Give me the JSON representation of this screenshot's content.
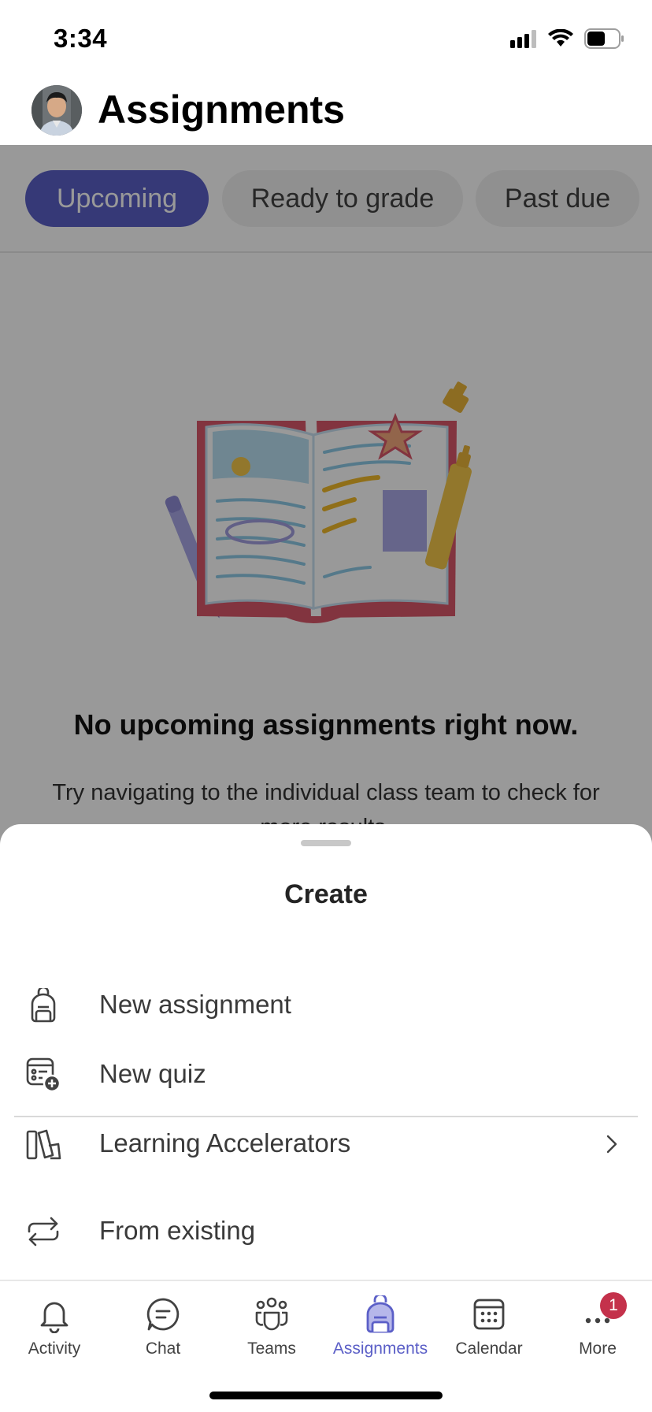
{
  "status_bar": {
    "time": "3:34"
  },
  "header": {
    "title": "Assignments"
  },
  "tabs": [
    {
      "label": "Upcoming",
      "selected": true
    },
    {
      "label": "Ready to grade",
      "selected": false
    },
    {
      "label": "Past due",
      "selected": false
    }
  ],
  "empty_state": {
    "title": "No upcoming assignments right now.",
    "description": "Try navigating to the individual class team to check for more results."
  },
  "sheet": {
    "title": "Create",
    "items": [
      {
        "label": "New assignment",
        "icon": "backpack-icon"
      },
      {
        "label": "New quiz",
        "icon": "quiz-add-icon"
      },
      {
        "label": "Learning Accelerators",
        "icon": "books-icon",
        "has_chevron": true
      },
      {
        "label": "From existing",
        "icon": "repeat-icon"
      }
    ]
  },
  "bottom_nav": {
    "items": [
      {
        "label": "Activity",
        "icon": "bell-icon"
      },
      {
        "label": "Chat",
        "icon": "chat-icon"
      },
      {
        "label": "Teams",
        "icon": "teams-icon"
      },
      {
        "label": "Assignments",
        "icon": "backpack-icon",
        "selected": true
      },
      {
        "label": "Calendar",
        "icon": "calendar-icon"
      },
      {
        "label": "More",
        "icon": "more-icon",
        "badge": "1"
      }
    ]
  },
  "colors": {
    "accent": "#5b5fc7",
    "badge": "#c4314b",
    "overlay": "rgba(0,0,0,0.40)"
  }
}
